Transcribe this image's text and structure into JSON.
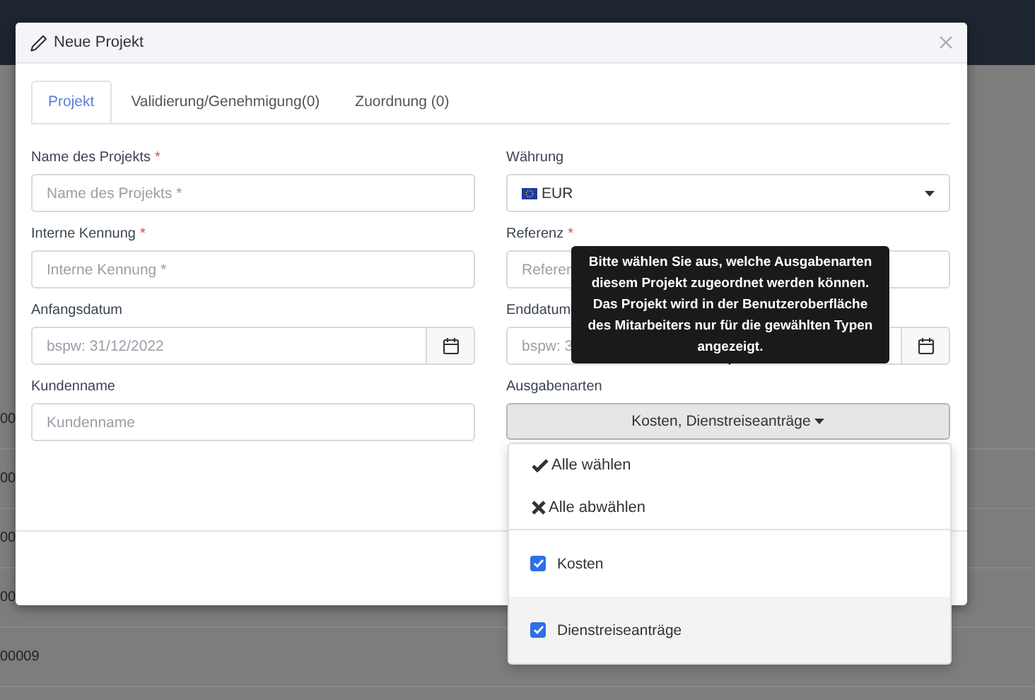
{
  "background": {
    "rows": [
      {
        "text": "00"
      },
      {
        "text": "00"
      },
      {
        "text": "00"
      },
      {
        "text": "00"
      },
      {
        "text": "00009"
      }
    ]
  },
  "modal": {
    "title": "Neue Projekt",
    "tabs": [
      {
        "label": "Projekt",
        "selected": true
      },
      {
        "label": "Validierung/Genehmigung(0)",
        "selected": false
      },
      {
        "label": "Zuordnung (0)",
        "selected": false
      }
    ],
    "fields": [
      {
        "kind": "text",
        "label": "Name des Projekts",
        "required_mark": "*",
        "placeholder": "Name des Projekts *"
      },
      {
        "kind": "select",
        "label": "Währung",
        "value": "EUR"
      },
      {
        "kind": "text",
        "label": "Interne Kennung",
        "required_mark": "*",
        "placeholder": "Interne Kennung *"
      },
      {
        "kind": "text",
        "label": "Referenz",
        "required_mark": "*",
        "placeholder": "Referen"
      },
      {
        "kind": "date",
        "label": "Anfangsdatum",
        "placeholder": "bspw: 31/12/2022"
      },
      {
        "kind": "date",
        "label": "Enddatum",
        "placeholder": "bspw: 3"
      },
      {
        "kind": "text",
        "label": "Kundenname",
        "placeholder": "Kundenname"
      },
      {
        "kind": "multiselect",
        "label": "Ausgabenarten",
        "value": "Kosten, Dienstreiseanträge",
        "tooltip": "Bitte wählen Sie aus, welche Ausgabenarten diesem Projekt zugeordnet werden können. Das Projekt wird in der Benutzeroberfläche des Mitarbeiters nur für die gewählten Typen angezeigt.",
        "actions": [
          {
            "kind": "check",
            "label": "Alle wählen"
          },
          {
            "kind": "cross",
            "label": "Alle abwählen"
          }
        ],
        "options": [
          {
            "label": "Kosten",
            "checked": true,
            "hovered": false
          },
          {
            "label": "Dienstreiseanträge",
            "checked": true,
            "hovered": true
          }
        ]
      }
    ]
  }
}
